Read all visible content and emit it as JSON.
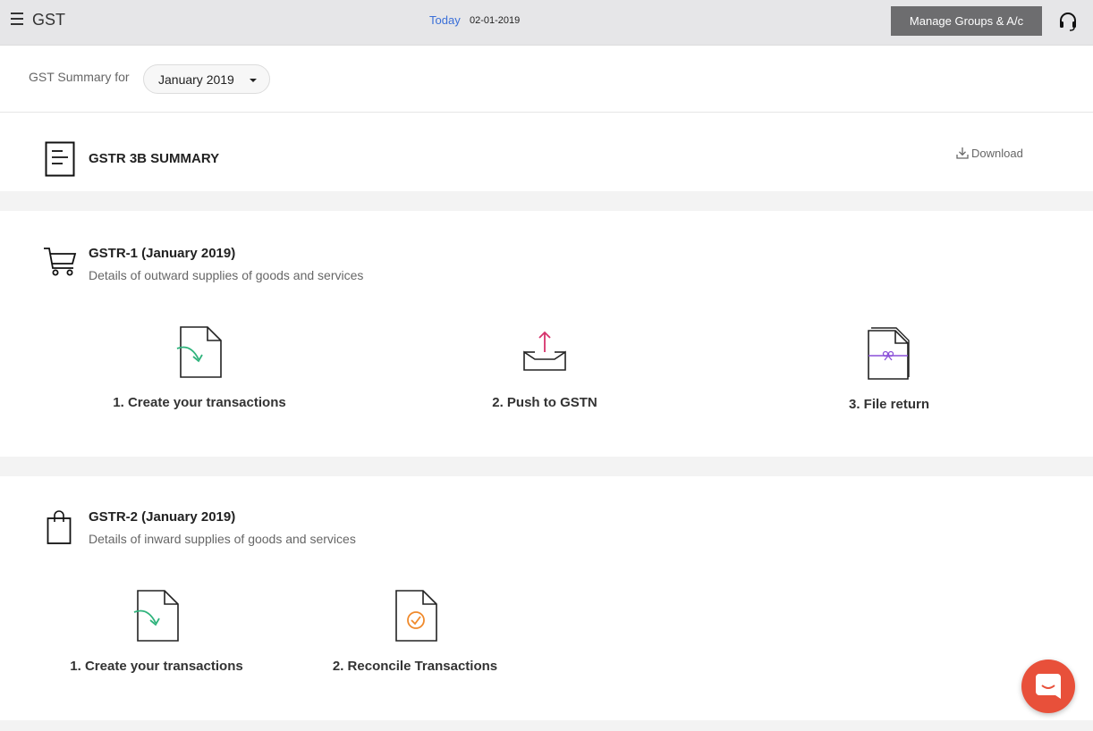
{
  "header": {
    "app_title": "GST",
    "today_label": "Today",
    "today_date": "02-01-2019",
    "manage_button": "Manage Groups & A/c",
    "icons": [
      "menu-icon",
      "headset-icon"
    ]
  },
  "summary": {
    "label": "GST Summary for",
    "selected_month": "January 2019"
  },
  "gstr3b": {
    "title": "GSTR 3B SUMMARY",
    "download_label": "Download",
    "icon": "document-icon"
  },
  "gstr1": {
    "title": "GSTR-1 (January 2019)",
    "subtitle": "Details of outward supplies of goods and services",
    "icon": "cart-icon",
    "steps": [
      {
        "label": "1. Create your transactions",
        "icon": "create-transaction-icon"
      },
      {
        "label": "2. Push to GSTN",
        "icon": "upload-tray-icon"
      },
      {
        "label": "3. File return",
        "icon": "file-return-icon"
      }
    ]
  },
  "gstr2": {
    "title": "GSTR-2 (January 2019)",
    "subtitle": "Details of inward supplies of goods and services",
    "icon": "shopping-bag-icon",
    "steps": [
      {
        "label": "1. Create your transactions",
        "icon": "create-transaction-icon"
      },
      {
        "label": "2. Reconcile Transactions",
        "icon": "reconcile-icon"
      }
    ]
  },
  "colors": {
    "accent_blue": "#3a6fd8",
    "button_gray": "#6d6d6f",
    "green": "#2fb37c",
    "pink": "#d6336c",
    "purple": "#8a4fd8",
    "orange": "#f08a2c",
    "chat_red": "#e8503a"
  }
}
